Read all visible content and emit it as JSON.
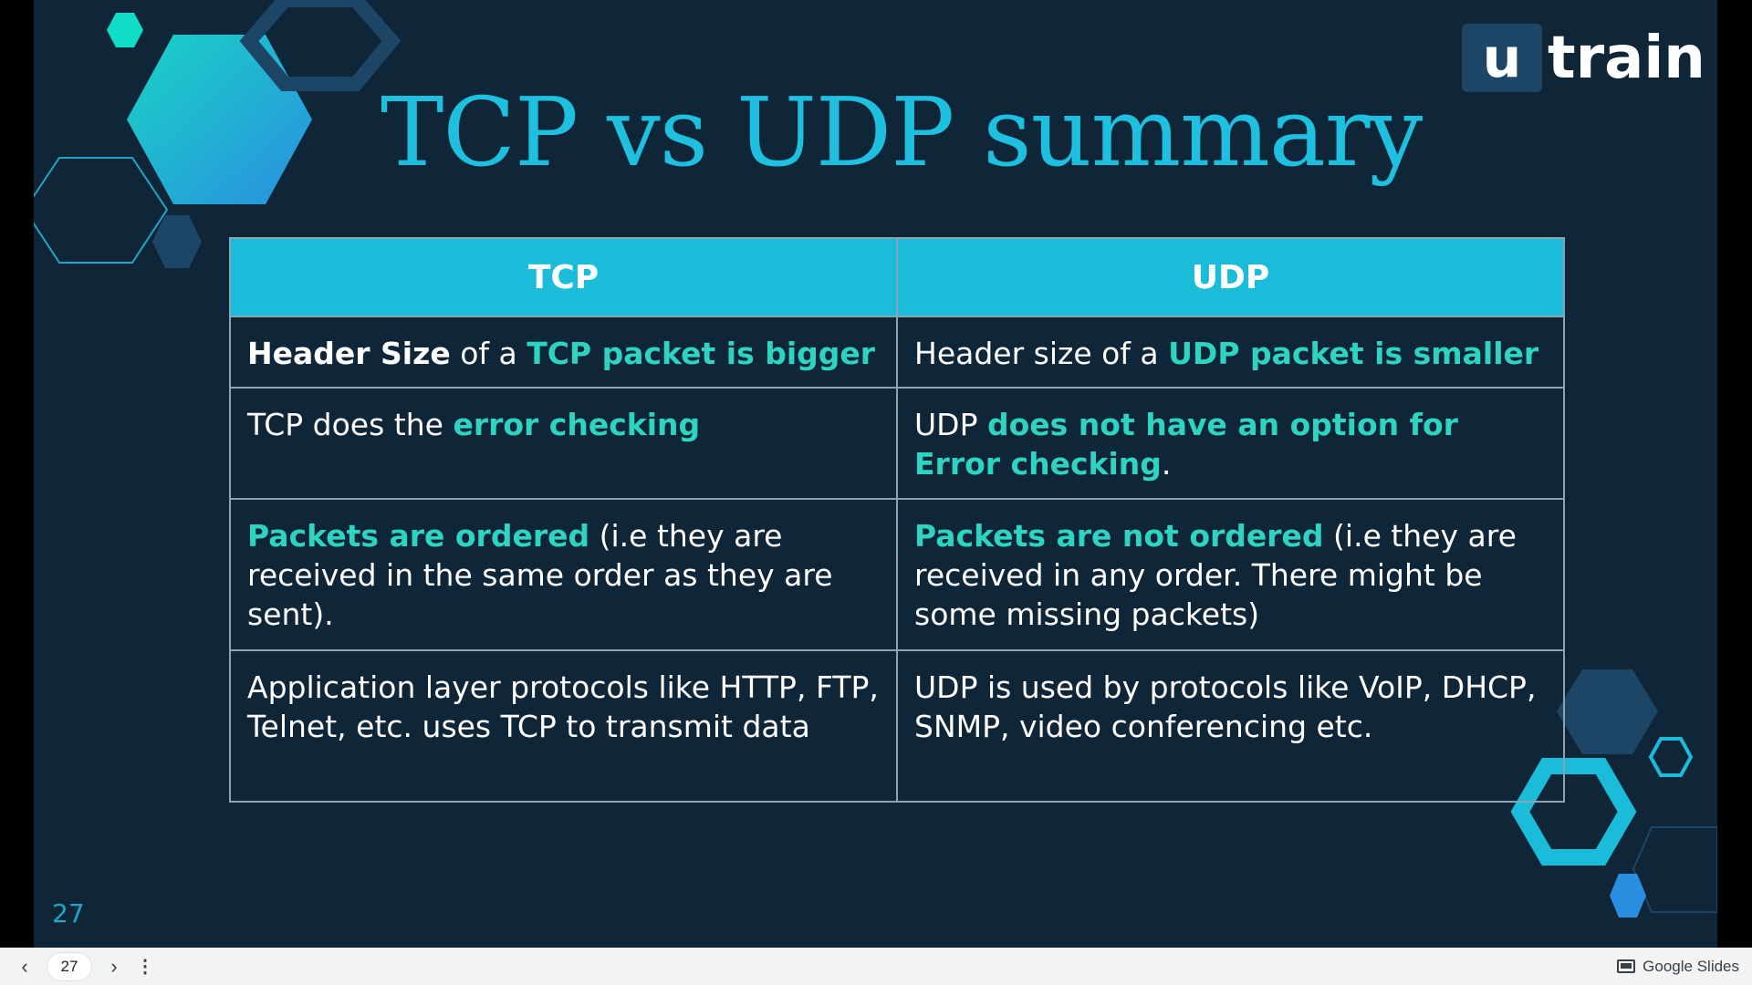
{
  "slide": {
    "title": "TCP vs UDP summary",
    "number": "27",
    "logo": {
      "mark": "u",
      "word": "train"
    }
  },
  "table": {
    "headers": [
      "TCP",
      "UDP"
    ],
    "rows": [
      {
        "tcp": [
          {
            "t": "Header Size",
            "s": "bw"
          },
          {
            "t": " of a ",
            "s": "n"
          },
          {
            "t": "TCP packet is bigger",
            "s": "hl"
          }
        ],
        "udp": [
          {
            "t": "Header size of a ",
            "s": "n"
          },
          {
            "t": "UDP packet is smaller",
            "s": "hl"
          }
        ]
      },
      {
        "tcp": [
          {
            "t": "TCP does the ",
            "s": "n"
          },
          {
            "t": "error checking",
            "s": "hl"
          }
        ],
        "udp": [
          {
            "t": "UDP ",
            "s": "n"
          },
          {
            "t": "does not have an option for Error checking",
            "s": "hl"
          },
          {
            "t": ".",
            "s": "n"
          }
        ]
      },
      {
        "tcp": [
          {
            "t": "Packets are ordered",
            "s": "hl"
          },
          {
            "t": "  (i.e they are received in the same order as they are sent).",
            "s": "n"
          }
        ],
        "udp": [
          {
            "t": "Packets are not ordered",
            "s": "hl"
          },
          {
            "t": " (i.e they are received in any order. There might be some missing packets)",
            "s": "n"
          }
        ]
      },
      {
        "tcp": [
          {
            "t": "Application layer protocols like HTTP, FTP, Telnet, etc. uses TCP to transmit data",
            "s": "n"
          }
        ],
        "udp": [
          {
            "t": "UDP is used by protocols like VoIP, DHCP, SNMP, video conferencing etc.",
            "s": "n"
          }
        ]
      }
    ]
  },
  "bottom_bar": {
    "page": "27",
    "prev_icon": "chevron-left-icon",
    "next_icon": "chevron-right-icon",
    "more_icon": "more-vert-icon",
    "brand": "Google Slides"
  },
  "colors": {
    "background": "#0f2538",
    "accent": "#1bbcd9",
    "highlight": "#2fd3c2"
  }
}
